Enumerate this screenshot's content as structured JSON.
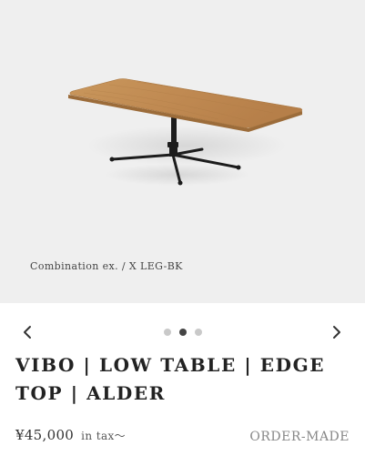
{
  "product": {
    "image_caption": "Combination ex. / X LEG-BK",
    "title": "VIBO | LOW TABLE | EDGE TOP | ALDER",
    "price": "¥45,000",
    "tax_note": "in tax～",
    "order_type": "ORDER-MADE"
  },
  "carousel": {
    "prev_icon": "chevron-left-icon",
    "next_icon": "chevron-right-icon",
    "slide_count": 3,
    "active_index": 1
  },
  "colors": {
    "hero_background": "#efefef",
    "tabletop_wood": "#c4935a",
    "leg_black": "#1c1c1c",
    "dot_active": "#444444",
    "dot_inactive": "#c9c9c9"
  }
}
